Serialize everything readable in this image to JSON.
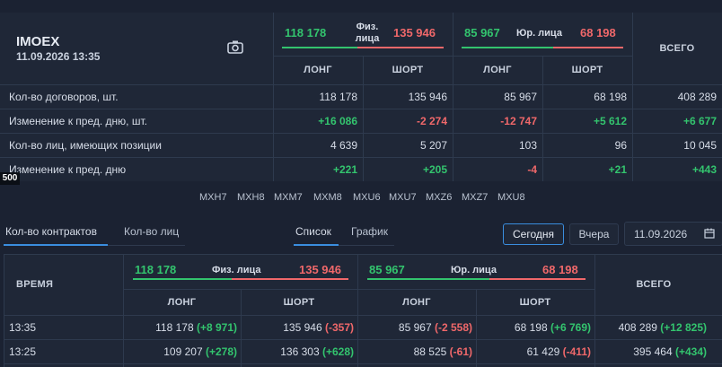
{
  "summary": {
    "title": "IMOEX",
    "datetime": "11.09.2026 13:35",
    "phys_label": "Физ. лица",
    "phys_long": "118 178",
    "phys_short": "135 946",
    "jur_label": "Юр. лица",
    "jur_long": "85 967",
    "jur_short": "68 198",
    "total_label": "ВСЕГО",
    "long_label": "ЛОНГ",
    "short_label": "ШОРТ",
    "rows": [
      {
        "label": "Кол-во договоров, шт.",
        "v": [
          "118 178",
          "135 946",
          "85 967",
          "68 198",
          "408 289"
        ]
      },
      {
        "label": "Изменение к пред. дню, шт.",
        "v": [
          "+16 086",
          "-2 274",
          "-12 747",
          "+5 612",
          "+6 677"
        ]
      },
      {
        "label": "Кол-во лиц, имеющих позиции",
        "v": [
          "4 639",
          "5 207",
          "103",
          "96",
          "10 045"
        ]
      },
      {
        "label": "Изменение к пред. дню",
        "v": [
          "+221",
          "+205",
          "-4",
          "+21",
          "+443"
        ]
      }
    ]
  },
  "overlay_badge": "500",
  "tickers": [
    "MXH7",
    "MXH8",
    "MXM7",
    "MXM8",
    "MXU6",
    "MXU7",
    "MXZ6",
    "MXZ7",
    "MXU8"
  ],
  "tabs": {
    "contracts": "Кол-во контрактов",
    "persons": "Кол-во лиц",
    "list": "Список",
    "chart": "График"
  },
  "period": {
    "today": "Сегодня",
    "yesterday": "Вчера",
    "date": "11.09.2026"
  },
  "table": {
    "time_label": "ВРЕМЯ",
    "phys_label": "Физ. лица",
    "phys_long": "118 178",
    "phys_short": "135 946",
    "jur_label": "Юр. лица",
    "jur_long": "85 967",
    "jur_short": "68 198",
    "total_label": "ВСЕГО",
    "long_label": "ЛОНГ",
    "short_label": "ШОРТ",
    "rows": [
      {
        "time": "13:35",
        "c": [
          [
            "118 178",
            "(+8 971)"
          ],
          [
            "135 946",
            "(-357)"
          ],
          [
            "85 967",
            "(-2 558)"
          ],
          [
            "68 198",
            "(+6 769)"
          ],
          [
            "408 289",
            "(+12 825)"
          ]
        ]
      },
      {
        "time": "13:25",
        "c": [
          [
            "109 207",
            "(+278)"
          ],
          [
            "136 303",
            "(+628)"
          ],
          [
            "88 525",
            "(-61)"
          ],
          [
            "61 429",
            "(-411)"
          ],
          [
            "395 464",
            "(+434)"
          ]
        ]
      }
    ]
  },
  "colors": {
    "positive": "#33c46e",
    "negative": "#f0686a",
    "accent": "#3a8dde"
  }
}
